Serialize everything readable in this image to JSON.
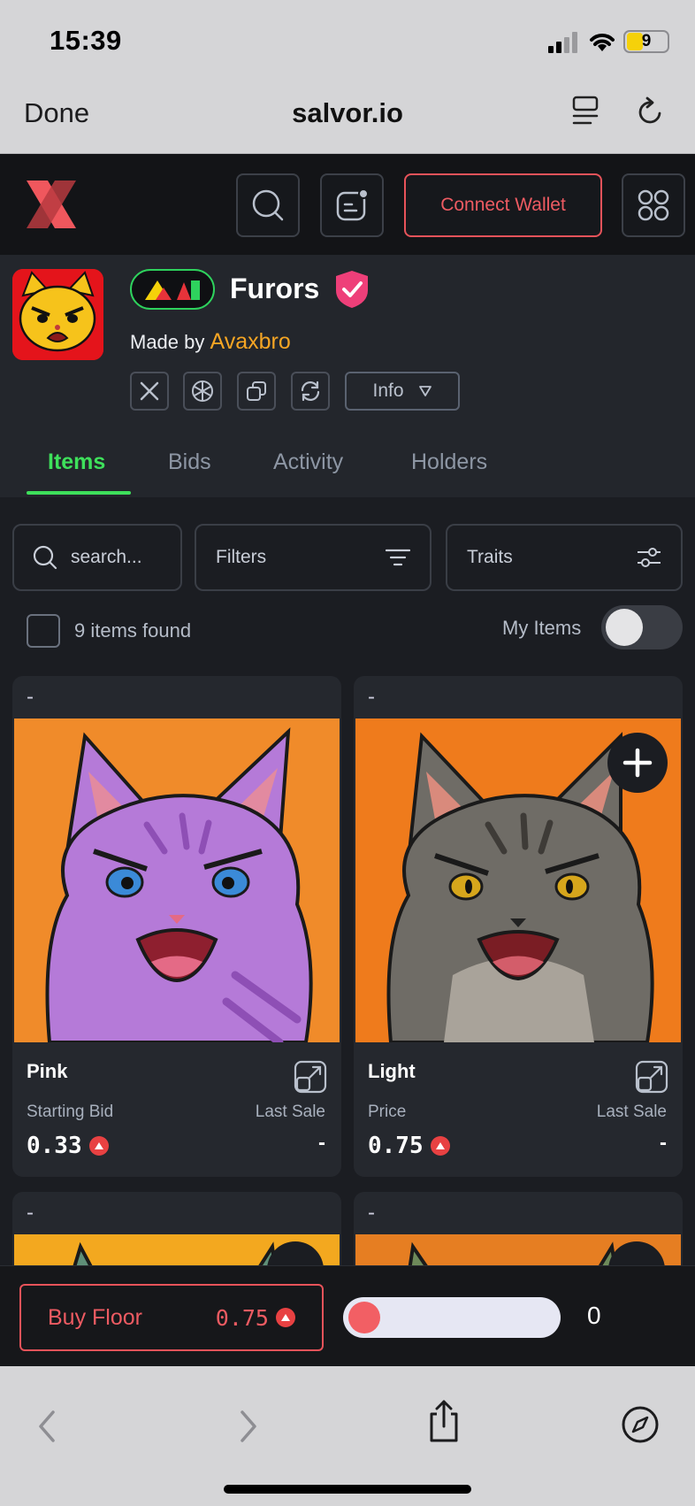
{
  "status_bar": {
    "time": "15:39",
    "battery": "9"
  },
  "browser": {
    "done_label": "Done",
    "url": "salvor.io"
  },
  "header": {
    "connect_label": "Connect Wallet"
  },
  "collection": {
    "name": "Furors",
    "made_by_prefix": "Made by ",
    "creator": "Avaxbro",
    "info_label": "Info"
  },
  "tabs": [
    {
      "label": "Items"
    },
    {
      "label": "Bids"
    },
    {
      "label": "Activity"
    },
    {
      "label": "Holders"
    }
  ],
  "filters": {
    "search_placeholder": "search...",
    "filters_label": "Filters",
    "traits_label": "Traits",
    "items_found": "9 items found",
    "my_items_label": "My Items"
  },
  "cards": [
    {
      "top_label": "-",
      "name": "Pink",
      "price_label": "Starting Bid",
      "price": "0.33",
      "last_sale_label": "Last Sale",
      "last_sale": "-"
    },
    {
      "top_label": "-",
      "name": "Light",
      "price_label": "Price",
      "price": "0.75",
      "last_sale_label": "Last Sale",
      "last_sale": "-"
    },
    {
      "top_label": "-"
    },
    {
      "top_label": "-"
    }
  ],
  "buy_bar": {
    "label": "Buy Floor",
    "price": "0.75",
    "count": "0"
  },
  "colors": {
    "accent_green": "#3ee05b",
    "accent_red": "#e7535a",
    "creator_orange": "#f5a524",
    "avax_red": "#e84142"
  }
}
